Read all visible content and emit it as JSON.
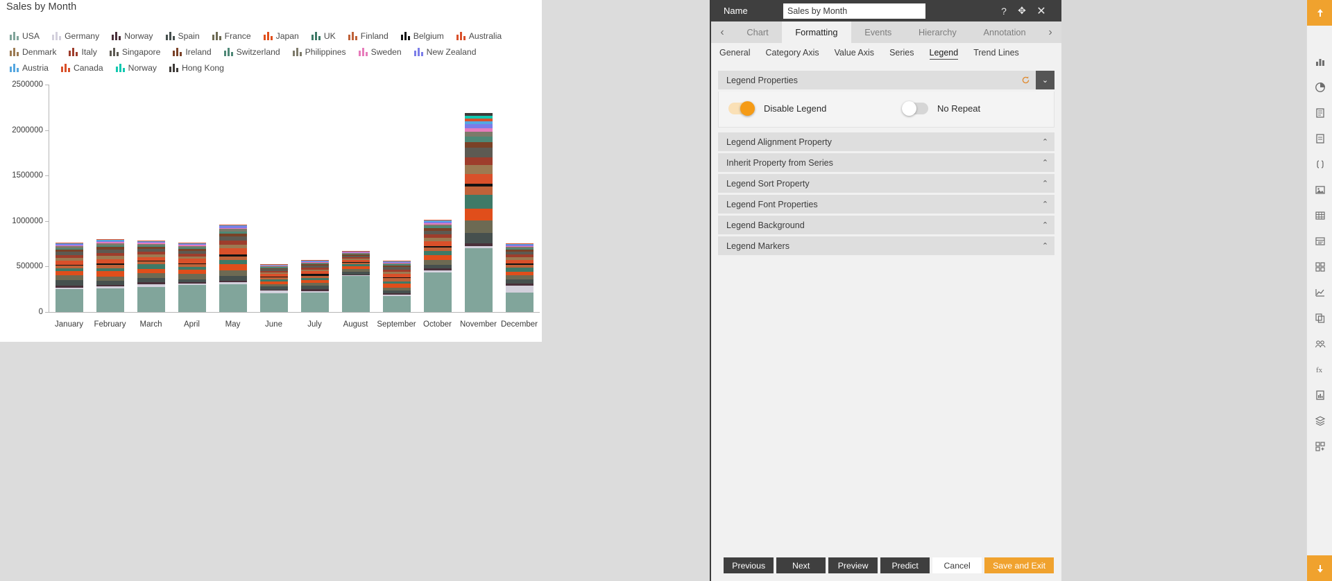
{
  "chart": {
    "title": "Sales by Month",
    "legend_items": [
      {
        "label": "USA",
        "color": "#81a59b"
      },
      {
        "label": "Germany",
        "color": "#d3d0dc"
      },
      {
        "label": "Norway",
        "color": "#4a303a"
      },
      {
        "label": "Spain",
        "color": "#46504e"
      },
      {
        "label": "France",
        "color": "#6d6a53"
      },
      {
        "label": "Japan",
        "color": "#e04e1b"
      },
      {
        "label": "UK",
        "color": "#3e7a67"
      },
      {
        "label": "Finland",
        "color": "#bf6239"
      },
      {
        "label": "Belgium",
        "color": "#121212"
      },
      {
        "label": "Australia",
        "color": "#d9502a"
      },
      {
        "label": "Denmark",
        "color": "#9c7a52"
      },
      {
        "label": "Italy",
        "color": "#9e3d2c"
      },
      {
        "label": "Singapore",
        "color": "#5d5a52"
      },
      {
        "label": "Ireland",
        "color": "#7a4127"
      },
      {
        "label": "Switzerland",
        "color": "#4e8876"
      },
      {
        "label": "Philippines",
        "color": "#7d7a6a"
      },
      {
        "label": "Sweden",
        "color": "#e77bbb"
      },
      {
        "label": "New Zealand",
        "color": "#7b7de8"
      },
      {
        "label": "Austria",
        "color": "#55a7e0"
      },
      {
        "label": "Canada",
        "color": "#d9502a"
      },
      {
        "label": "Norway",
        "color": "#12c8b0"
      },
      {
        "label": "Hong Kong",
        "color": "#3e3b38"
      }
    ]
  },
  "chart_data": {
    "type": "bar",
    "subtype": "stacked",
    "title": "Sales by Month",
    "xlabel": "",
    "ylabel": "",
    "ylim": [
      0,
      2500000
    ],
    "yticks": [
      0,
      500000,
      1000000,
      1500000,
      2000000,
      2500000
    ],
    "ytick_labels": [
      "0",
      "500000",
      "1000000",
      "1500000",
      "2000000",
      "2500000"
    ],
    "grid": false,
    "legend_position": "top",
    "categories": [
      "January",
      "February",
      "March",
      "April",
      "May",
      "June",
      "July",
      "August",
      "September",
      "October",
      "November",
      "December"
    ],
    "totals": [
      760000,
      790000,
      810000,
      780000,
      940000,
      540000,
      590000,
      660000,
      580000,
      1120000,
      2230000,
      745000
    ],
    "series": [
      {
        "name": "USA",
        "color": "#81a59b",
        "values": [
          248000,
          262000,
          272000,
          300000,
          305000,
          205000,
          215000,
          395000,
          178000,
          437000,
          700000,
          210000
        ]
      },
      {
        "name": "Germany",
        "color": "#d3d0dc",
        "values": [
          22000,
          18000,
          36000,
          12000,
          20000,
          30000,
          16000,
          10000,
          12000,
          18000,
          22000,
          80000
        ]
      },
      {
        "name": "Norway",
        "color": "#4a303a",
        "values": [
          18000,
          16000,
          20000,
          14000,
          22000,
          12000,
          18000,
          10000,
          14000,
          22000,
          30000,
          22000
        ]
      },
      {
        "name": "Spain",
        "color": "#46504e",
        "values": [
          64000,
          44000,
          48000,
          32000,
          52000,
          32000,
          44000,
          26000,
          30000,
          40000,
          118000,
          50000
        ]
      },
      {
        "name": "France",
        "color": "#6d6a53",
        "values": [
          56000,
          50000,
          52000,
          62000,
          60000,
          28000,
          30000,
          32000,
          36000,
          56000,
          140000,
          44000
        ]
      },
      {
        "name": "Japan",
        "color": "#e04e1b",
        "values": [
          42000,
          58000,
          46000,
          44000,
          70000,
          30000,
          28000,
          30000,
          44000,
          56000,
          128000,
          40000
        ]
      },
      {
        "name": "UK",
        "color": "#3e7a67",
        "values": [
          28000,
          30000,
          50000,
          30000,
          40000,
          24000,
          26000,
          22000,
          24000,
          40000,
          150000,
          40000
        ]
      },
      {
        "name": "Finland",
        "color": "#bf6239",
        "values": [
          30000,
          38000,
          30000,
          34000,
          44000,
          22000,
          20000,
          18000,
          34000,
          44000,
          96000,
          36000
        ]
      },
      {
        "name": "Belgium",
        "color": "#121212",
        "values": [
          14000,
          16000,
          12000,
          10000,
          20000,
          8000,
          26000,
          8000,
          10000,
          14000,
          24000,
          12000
        ]
      },
      {
        "name": "Australia",
        "color": "#d9502a",
        "values": [
          44000,
          48000,
          38000,
          46000,
          66000,
          26000,
          26000,
          22000,
          40000,
          50000,
          110000,
          38000
        ]
      },
      {
        "name": "Denmark",
        "color": "#9c7a52",
        "values": [
          32000,
          36000,
          30000,
          30000,
          44000,
          18000,
          20000,
          16000,
          24000,
          38000,
          96000,
          30000
        ]
      },
      {
        "name": "Italy",
        "color": "#9e3d2c",
        "values": [
          30000,
          34000,
          28000,
          28000,
          42000,
          16000,
          18000,
          14000,
          22000,
          36000,
          90000,
          28000
        ]
      },
      {
        "name": "Singapore",
        "color": "#5d5a52",
        "values": [
          36000,
          40000,
          34000,
          32000,
          48000,
          20000,
          22000,
          18000,
          26000,
          44000,
          104000,
          34000
        ]
      },
      {
        "name": "Ireland",
        "color": "#7a4127",
        "values": [
          22000,
          24000,
          20000,
          20000,
          30000,
          12000,
          14000,
          10000,
          16000,
          26000,
          64000,
          20000
        ]
      },
      {
        "name": "Switzerland",
        "color": "#4e8876",
        "values": [
          20000,
          22000,
          18000,
          18000,
          26000,
          10000,
          12000,
          10000,
          14000,
          24000,
          58000,
          18000
        ]
      },
      {
        "name": "Philippines",
        "color": "#7d7a6a",
        "values": [
          18000,
          20000,
          16000,
          16000,
          24000,
          10000,
          10000,
          8000,
          12000,
          20000,
          52000,
          16000
        ]
      },
      {
        "name": "Sweden",
        "color": "#e77bbb",
        "values": [
          10000,
          12000,
          10000,
          10000,
          14000,
          6000,
          8000,
          6000,
          8000,
          14000,
          40000,
          10000
        ]
      },
      {
        "name": "New Zealand",
        "color": "#7b7de8",
        "values": [
          12000,
          14000,
          12000,
          10000,
          16000,
          6000,
          8000,
          6000,
          8000,
          16000,
          44000,
          12000
        ]
      },
      {
        "name": "Austria",
        "color": "#55a7e0",
        "values": [
          8000,
          10000,
          8000,
          8000,
          12000,
          6000,
          6000,
          4000,
          6000,
          12000,
          34000,
          8000
        ]
      },
      {
        "name": "Canada",
        "color": "#d9502a",
        "values": [
          6000,
          8000,
          6000,
          6000,
          10000,
          4000,
          6000,
          4000,
          6000,
          10000,
          28000,
          6000
        ]
      },
      {
        "name": "Norway2",
        "color": "#12c8b0",
        "values": [
          0,
          0,
          0,
          0,
          0,
          0,
          0,
          0,
          0,
          0,
          30000,
          0
        ]
      },
      {
        "name": "Hong Kong",
        "color": "#3e3b38",
        "values": [
          0,
          0,
          0,
          0,
          0,
          0,
          0,
          0,
          0,
          0,
          28000,
          0
        ]
      }
    ]
  },
  "panel": {
    "name_label": "Name",
    "name_value": "Sales by Month",
    "name_placeholder": "Enter name",
    "help_icon": "?",
    "move_icon": "✥",
    "close_icon": "✕",
    "prev_arrow": "‹",
    "next_arrow": "›",
    "tabs": [
      {
        "label": "Chart",
        "active": false
      },
      {
        "label": "Formatting",
        "active": true
      },
      {
        "label": "Events",
        "active": false
      },
      {
        "label": "Hierarchy",
        "active": false
      },
      {
        "label": "Annotation",
        "active": false
      }
    ],
    "subtabs": [
      {
        "label": "General",
        "active": false
      },
      {
        "label": "Category Axis",
        "active": false
      },
      {
        "label": "Value Axis",
        "active": false
      },
      {
        "label": "Series",
        "active": false
      },
      {
        "label": "Legend",
        "active": true
      },
      {
        "label": "Trend Lines",
        "active": false
      }
    ],
    "sections": [
      {
        "title": "Legend Properties",
        "open": true,
        "chevron": "⌄",
        "has_reset": true
      },
      {
        "title": "Legend Alignment Property",
        "open": false,
        "chevron": "⌃",
        "has_reset": false
      },
      {
        "title": "Inherit Property from Series",
        "open": false,
        "chevron": "⌃",
        "has_reset": false
      },
      {
        "title": "Legend Sort Property",
        "open": false,
        "chevron": "⌃",
        "has_reset": false
      },
      {
        "title": "Legend Font Properties",
        "open": false,
        "chevron": "⌃",
        "has_reset": false
      },
      {
        "title": "Legend Background",
        "open": false,
        "chevron": "⌃",
        "has_reset": false
      },
      {
        "title": "Legend Markers",
        "open": false,
        "chevron": "⌃",
        "has_reset": false
      }
    ],
    "toggles": [
      {
        "label": "Disable Legend",
        "state": "on"
      },
      {
        "label": "No Repeat",
        "state": "off"
      }
    ],
    "footer_buttons": [
      {
        "label": "Previous",
        "style": "dark"
      },
      {
        "label": "Next",
        "style": "dark"
      },
      {
        "label": "Preview",
        "style": "dark"
      },
      {
        "label": "Predict",
        "style": "dark"
      },
      {
        "label": "Cancel",
        "style": "light"
      },
      {
        "label": "Save and Exit",
        "style": "amber"
      }
    ]
  },
  "rail": {
    "top_icons": [
      "upload-icon"
    ],
    "mid_icons": [
      "bar-chart-icon",
      "pie-chart-icon",
      "page-icon",
      "document-icon",
      "code-icon",
      "image-icon",
      "table-icon",
      "list-icon",
      "tiles-icon",
      "line-chart-icon",
      "copy-icon",
      "group-icon",
      "formula-icon",
      "report-icon",
      "layers-icon",
      "add-widget-icon"
    ],
    "bottom_icons": [
      "download-icon"
    ]
  },
  "colors": {
    "accent": "#f0a22e",
    "panel_header": "#3f3f3f",
    "panel_bg": "#f1f1f1",
    "gutter": "#dcdcdc"
  }
}
